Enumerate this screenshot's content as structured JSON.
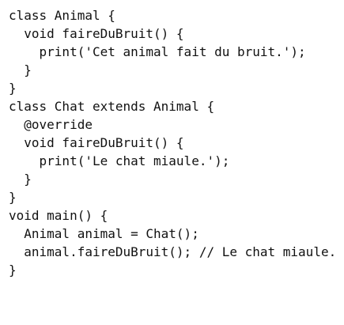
{
  "code": {
    "lines": [
      "class Animal {",
      "  void faireDuBruit() {",
      "    print('Cet animal fait du bruit.');",
      "  }",
      "}",
      "class Chat extends Animal {",
      "  @override",
      "  void faireDuBruit() {",
      "    print('Le chat miaule.');",
      "  }",
      "}",
      "void main() {",
      "  Animal animal = Chat();",
      "  animal.faireDuBruit(); // Le chat miaule.",
      "}"
    ]
  }
}
